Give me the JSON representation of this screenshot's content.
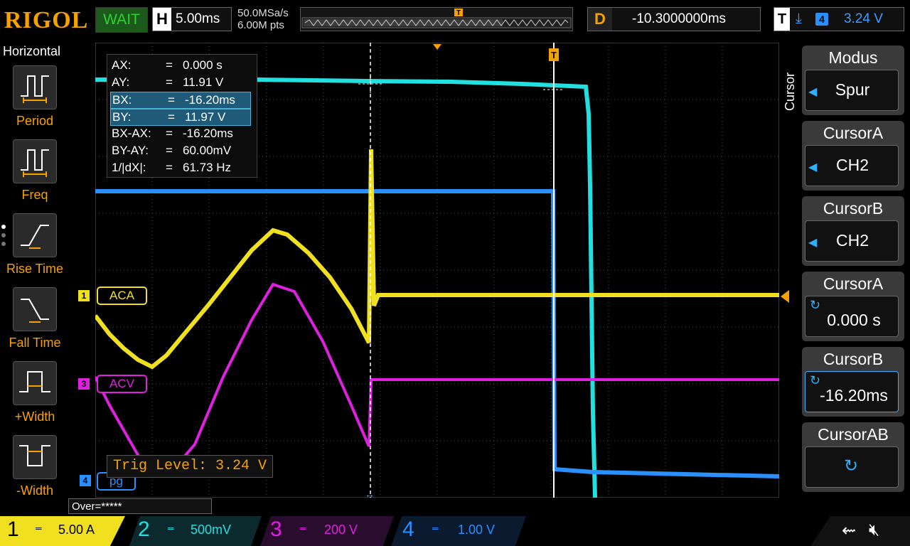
{
  "brand": "RIGOL",
  "status": "WAIT",
  "timebase": {
    "key": "H",
    "value": "5.00ms"
  },
  "acq": {
    "rate": "50.0MSa/s",
    "points": "6.00M pts"
  },
  "delay": {
    "key": "D",
    "value": "-10.3000000ms"
  },
  "trigger": {
    "key": "T",
    "source": "4",
    "level": "3.24 V"
  },
  "left_panel": {
    "title": "Horizontal",
    "items": [
      {
        "label": "Period",
        "icon": "period-icon"
      },
      {
        "label": "Freq",
        "icon": "freq-icon"
      },
      {
        "label": "Rise Time",
        "icon": "rise-time-icon"
      },
      {
        "label": "Fall Time",
        "icon": "fall-time-icon"
      },
      {
        "label": "+Width",
        "icon": "plus-width-icon"
      },
      {
        "label": "-Width",
        "icon": "minus-width-icon"
      }
    ]
  },
  "readout": [
    {
      "k": "AX:",
      "eq": "=",
      "v": "0.000 s"
    },
    {
      "k": "AY:",
      "eq": "=",
      "v": "11.91 V"
    },
    {
      "k": "BX:",
      "eq": "=",
      "v": "-16.20ms"
    },
    {
      "k": "BY:",
      "eq": "=",
      "v": "11.97 V"
    },
    {
      "k": "BX-AX:",
      "eq": "=",
      "v": "-16.20ms"
    },
    {
      "k": "BY-AY:",
      "eq": "=",
      "v": "60.00mV"
    },
    {
      "k": "1/|dX|:",
      "eq": "=",
      "v": "61.73 Hz"
    }
  ],
  "channels": {
    "ch1": {
      "num": "1",
      "label": "ACA",
      "scale": "5.00 A",
      "color": "#f0e020"
    },
    "ch2": {
      "num": "2",
      "scale": "500mV",
      "color": "#22e0e0"
    },
    "ch3": {
      "num": "3",
      "label": "ACV",
      "scale": "200 V",
      "color": "#e020e0"
    },
    "ch4": {
      "num": "4",
      "label": "pg",
      "scale": "1.00 V",
      "color": "#2a8fff"
    }
  },
  "trig_level_text": "Trig Level: 3.24 V",
  "over_text": "Over=*****",
  "right_panel": {
    "side_label": "Cursor",
    "items": [
      {
        "title": "Modus",
        "value": "Spur"
      },
      {
        "title": "CursorA",
        "value": "CH2"
      },
      {
        "title": "CursorB",
        "value": "CH2"
      },
      {
        "title": "CursorA",
        "value": "0.000 s"
      },
      {
        "title": "CursorB",
        "value": "-16.20ms"
      },
      {
        "title": "CursorAB",
        "value": ""
      }
    ]
  },
  "bottom_icons": [
    "usb-icon",
    "speaker-mute-icon"
  ]
}
